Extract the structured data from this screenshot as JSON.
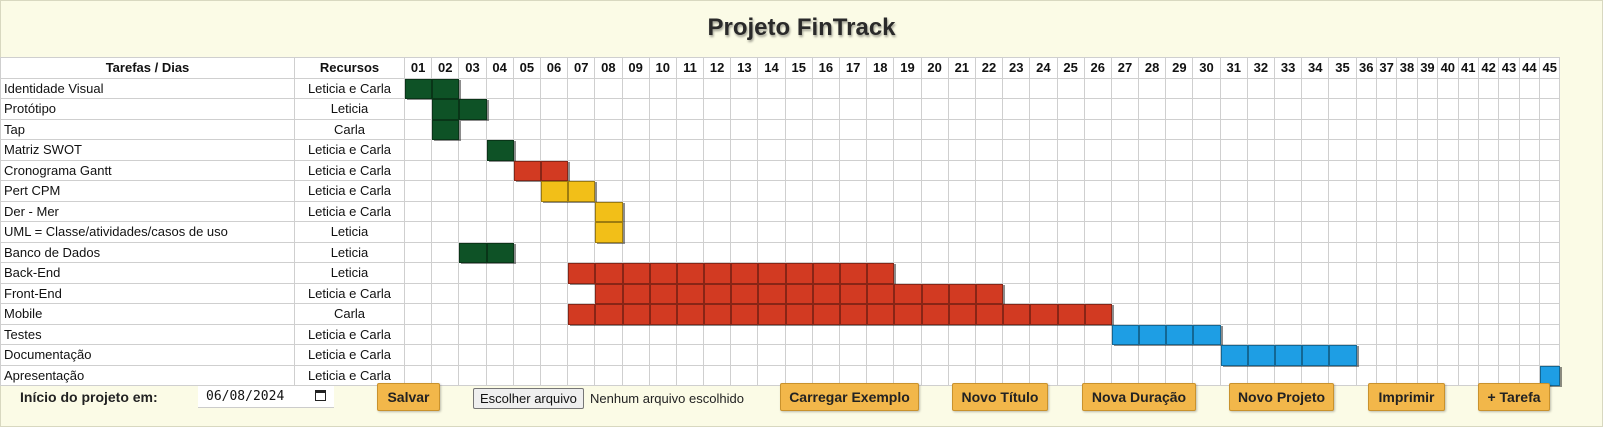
{
  "title": "Projeto FinTrack",
  "columns": {
    "tasks": "Tarefas / Dias",
    "resources": "Recursos"
  },
  "days": [
    "01",
    "02",
    "03",
    "04",
    "05",
    "06",
    "07",
    "08",
    "09",
    "10",
    "11",
    "12",
    "13",
    "14",
    "15",
    "16",
    "17",
    "18",
    "19",
    "20",
    "21",
    "22",
    "23",
    "24",
    "25",
    "26",
    "27",
    "28",
    "29",
    "30",
    "31",
    "32",
    "33",
    "34",
    "35",
    "36",
    "37",
    "38",
    "39",
    "40",
    "41",
    "42",
    "43",
    "44",
    "45"
  ],
  "colors": {
    "green": "#0e5226",
    "red": "#d23a22",
    "yellow": "#f2bf18",
    "blue": "#1e9ee4"
  },
  "tasks": [
    {
      "name": "Identidade Visual",
      "resource": "Leticia e Carla",
      "start": 1,
      "end": 2,
      "color": "green"
    },
    {
      "name": "Protótipo",
      "resource": "Leticia",
      "start": 2,
      "end": 3,
      "color": "green"
    },
    {
      "name": "Tap",
      "resource": "Carla",
      "start": 2,
      "end": 2,
      "color": "green"
    },
    {
      "name": "Matriz SWOT",
      "resource": "Leticia e Carla",
      "start": 4,
      "end": 4,
      "color": "green"
    },
    {
      "name": "Cronograma Gantt",
      "resource": "Leticia e Carla",
      "start": 5,
      "end": 6,
      "color": "red"
    },
    {
      "name": "Pert CPM",
      "resource": "Leticia e Carla",
      "start": 6,
      "end": 7,
      "color": "yellow"
    },
    {
      "name": "Der - Mer",
      "resource": "Leticia e Carla",
      "start": 8,
      "end": 8,
      "color": "yellow"
    },
    {
      "name": "UML = Classe/atividades/casos de uso",
      "resource": "Leticia",
      "start": 8,
      "end": 8,
      "color": "yellow"
    },
    {
      "name": "Banco de Dados",
      "resource": "Leticia",
      "start": 3,
      "end": 4,
      "color": "green"
    },
    {
      "name": "Back-End",
      "resource": "Leticia",
      "start": 7,
      "end": 18,
      "color": "red"
    },
    {
      "name": "Front-End",
      "resource": "Leticia e Carla",
      "start": 8,
      "end": 22,
      "color": "red"
    },
    {
      "name": "Mobile",
      "resource": "Carla",
      "start": 7,
      "end": 26,
      "color": "red"
    },
    {
      "name": "Testes",
      "resource": "Leticia e Carla",
      "start": 27,
      "end": 30,
      "color": "blue"
    },
    {
      "name": "Documentação",
      "resource": "Leticia e Carla",
      "start": 31,
      "end": 35,
      "color": "blue"
    },
    {
      "name": "Apresentação",
      "resource": "Leticia e Carla",
      "start": 45,
      "end": 45,
      "color": "blue"
    }
  ],
  "controls": {
    "start_label": "Início do projeto em:",
    "start_date": "06/08/2024",
    "save": "Salvar",
    "file_button": "Escolher arquivo",
    "file_status": "Nenhum arquivo escolhido",
    "load_example": "Carregar Exemplo",
    "new_title": "Novo Título",
    "new_duration": "Nova Duração",
    "new_project": "Novo Projeto",
    "print": "Imprimir",
    "add_task": "+ Tarefa"
  }
}
